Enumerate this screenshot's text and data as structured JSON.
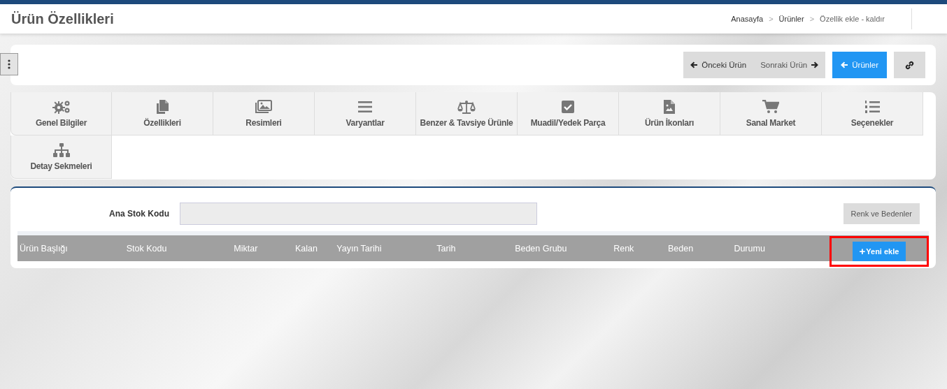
{
  "page_title": "Ürün Özellikleri",
  "breadcrumb": [
    "Anasayfa",
    "Ürünler",
    "Özellik ekle - kaldır"
  ],
  "breadcrumb_separator": ">",
  "nav_buttons": [
    {
      "kind": "prev",
      "label": "Önceki Ürün"
    },
    {
      "kind": "next",
      "label": "Sonraki Ürün"
    },
    {
      "kind": "primary",
      "label": "Ürünler"
    },
    {
      "kind": "link"
    }
  ],
  "tabs": [
    {
      "label": "Genel Bilgiler",
      "selected": false
    },
    {
      "label": "Özellikleri",
      "selected": false
    },
    {
      "label": "Resimleri",
      "selected": false
    },
    {
      "label": "Varyantlar",
      "selected": false
    },
    {
      "label": "Benzer & Tavsiye Ürünle",
      "selected": false
    },
    {
      "label": "Muadil/Yedek Parça",
      "selected": false
    },
    {
      "label": "Ürün İkonları",
      "selected": false
    },
    {
      "label": "Sanal Market",
      "selected": false
    },
    {
      "label": "Seçenekler",
      "selected": false
    },
    {
      "label": "Detay Sekmeleri",
      "selected": false
    }
  ],
  "stock_code": {
    "label": "Ana Stok Kodu"
  },
  "colors_sizes_button": "Renk ve Bedenler",
  "table": {
    "columns": [
      "Ürün Başlığı",
      "Stok Kodu",
      "Miktar",
      "Kalan",
      "Yayın Tarihi",
      "Tarih",
      "Beden Grubu",
      "Renk",
      "Beden",
      "Durumu"
    ]
  },
  "add_button": {
    "icon": "+",
    "label": "Yeni ekle",
    "highlighted": true
  }
}
